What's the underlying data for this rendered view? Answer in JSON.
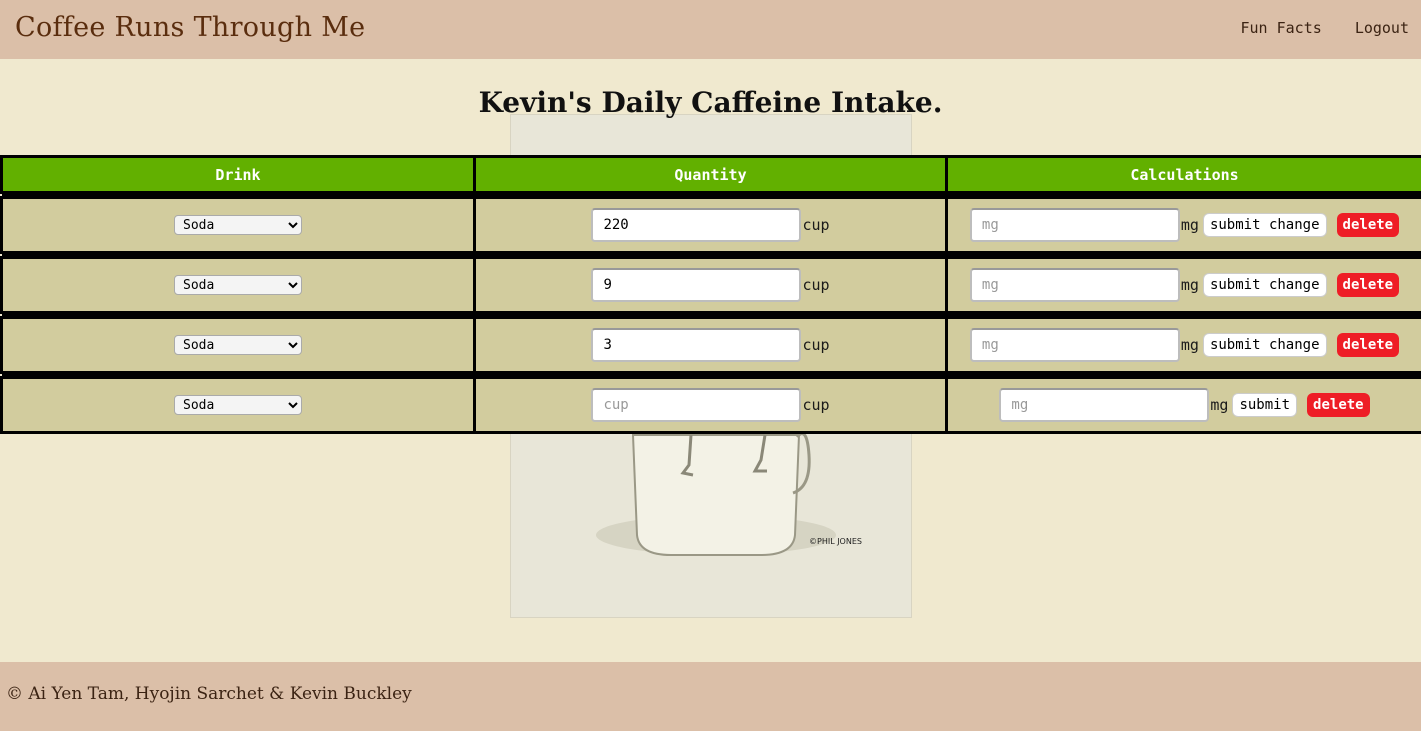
{
  "navbar": {
    "brand": "Coffee Runs Through Me",
    "links": [
      "Fun Facts",
      "Logout"
    ]
  },
  "page_title": "Kevin's Daily Caffeine Intake.",
  "poster": {
    "credit": "©PHIL JONES"
  },
  "table": {
    "headers": [
      "Drink",
      "Quantity",
      "Calculations"
    ],
    "rows": [
      {
        "drink": "Soda",
        "quantity": "220",
        "quantity_placeholder": "cup",
        "unit": "cup",
        "mg_placeholder": "mg",
        "mg_unit": "mg",
        "submit_label": "submit change",
        "delete_label": "delete"
      },
      {
        "drink": "Soda",
        "quantity": "9",
        "quantity_placeholder": "cup",
        "unit": "cup",
        "mg_placeholder": "mg",
        "mg_unit": "mg",
        "submit_label": "submit change",
        "delete_label": "delete"
      },
      {
        "drink": "Soda",
        "quantity": "3",
        "quantity_placeholder": "cup",
        "unit": "cup",
        "mg_placeholder": "mg",
        "mg_unit": "mg",
        "submit_label": "submit change",
        "delete_label": "delete"
      },
      {
        "drink": "Soda",
        "quantity": "",
        "quantity_placeholder": "cup",
        "unit": "cup",
        "mg_placeholder": "mg",
        "mg_unit": "mg",
        "submit_label": "submit",
        "delete_label": "delete"
      }
    ]
  },
  "footer": {
    "text": "© Ai Yen Tam, Hyojin Sarchet & Kevin Buckley"
  },
  "colors": {
    "navbar_bg": "#dbbfa8",
    "page_bg": "#f0e9cf",
    "header_bg": "#62b000",
    "cell_bg": "#d2cc9e",
    "delete_bg": "#ee1d26"
  }
}
